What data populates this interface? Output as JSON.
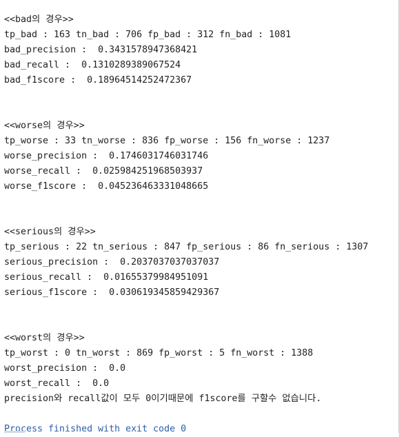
{
  "console": {
    "lines": [
      "<<bad의 경우>>",
      "tp_bad : 163 tn_bad : 706 fp_bad : 312 fn_bad : 1081",
      "bad_precision :  0.3431578947368421",
      "bad_recall :  0.1310289389067524",
      "bad_f1score :  0.18964514252472367",
      "<<worse의 경우>>",
      "tp_worse : 33 tn_worse : 836 fp_worse : 156 fn_worse : 1237",
      "worse_precision :  0.1746031746031746",
      "worse_recall :  0.025984251968503937",
      "worse_f1score :  0.045236463331048665",
      "<<serious의 경우>>",
      "tp_serious : 22 tn_serious : 847 fp_serious : 86 fn_serious : 1307",
      "serious_precision :  0.2037037037037037",
      "serious_recall :  0.01655379984951091",
      "serious_f1score :  0.030619345859429367",
      "<<worst의 경우>>",
      "tp_worst : 0 tn_worst : 869 fp_worst : 5 fn_worst : 1388",
      "worst_precision :  0.0",
      "worst_recall :  0.0",
      "precision와 recall값이 모두 0이기때문에 f1score를 구할수 없습니다."
    ],
    "exit_message": "Process finished with exit code 0"
  }
}
